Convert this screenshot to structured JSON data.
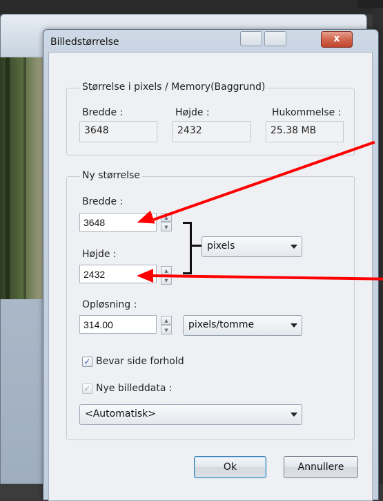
{
  "window": {
    "title": "Billedstørrelse",
    "close_label": "x"
  },
  "current_size": {
    "legend": "Størrelse i pixels / Memory(Baggrund)",
    "width_label": "Bredde :",
    "width_value": "3648",
    "height_label": "Højde :",
    "height_value": "2432",
    "memory_label": "Hukommelse :",
    "memory_value": "25.38 MB"
  },
  "new_size": {
    "legend": "Ny størrelse",
    "width_label": "Bredde :",
    "width_value": "3648",
    "height_label": "Højde :",
    "height_value": "2432",
    "unit_selected": "pixels",
    "resolution_label": "Opløsning :",
    "resolution_value": "314.00",
    "resolution_unit_selected": "pixels/tomme",
    "keep_ratio_label": "Bevar side forhold",
    "keep_ratio_checked": true,
    "new_data_label": "Nye billeddata :",
    "new_data_checked": true,
    "new_data_selected": "<Automatisk>"
  },
  "buttons": {
    "ok_label": "Ok",
    "cancel_label": "Annullere"
  },
  "colors": {
    "annotation_arrow": "#ff0000",
    "close_button": "#c0442b"
  }
}
